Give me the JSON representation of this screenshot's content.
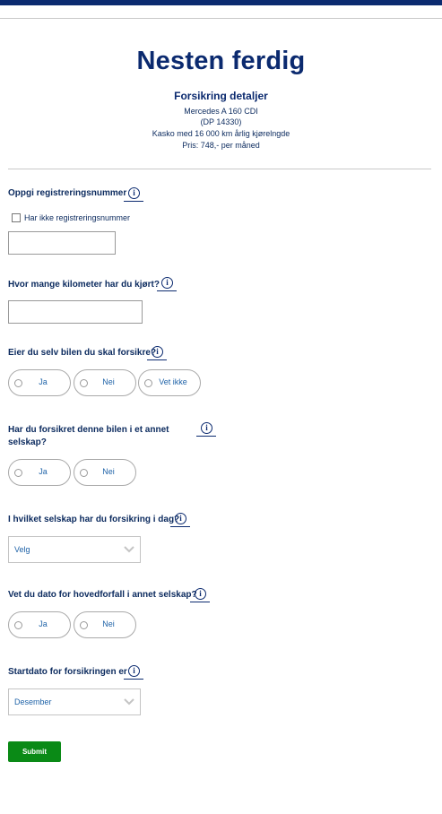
{
  "header": {
    "title": "Nesten ferdig",
    "details_title": "Forsikring detaljer",
    "details": [
      "Mercedes A 160 CDI",
      "(DP 14330)",
      "Kasko med 16 000 km årlig kjørelngde",
      "Pris: 748,- per måned"
    ]
  },
  "form": {
    "reg": {
      "label": "Oppgi registreringsnummer",
      "checkbox_label": "Har ikke registreringsnummer",
      "value": ""
    },
    "km": {
      "label": "Hvor mange kilometer har du kjørt?",
      "value": ""
    },
    "owner": {
      "label": "Eier du selv bilen du skal forsikre?",
      "options": [
        "Ja",
        "Nei",
        "Vet ikke"
      ]
    },
    "insured_elsewhere": {
      "label_line1": "Har du forsikret denne bilen i et annet",
      "label_line2": "selskap?",
      "options": [
        "Ja",
        "Nei"
      ]
    },
    "company": {
      "label": "I hvilket selskap har du forsikring i dag?",
      "selected": "Velg"
    },
    "due_date": {
      "label": "Vet du dato for hovedforfall i annet selskap?",
      "options": [
        "Ja",
        "Nei"
      ]
    },
    "start_date": {
      "label": "Startdato for forsikringen er",
      "selected": "Desember"
    },
    "submit_label": "Submit"
  },
  "icons": {
    "info": "info-icon",
    "chevron": "chevron-down-icon"
  },
  "colors": {
    "brand": "#0b2a6f",
    "submit": "#0a8a16",
    "option_text": "#1f63a8"
  }
}
